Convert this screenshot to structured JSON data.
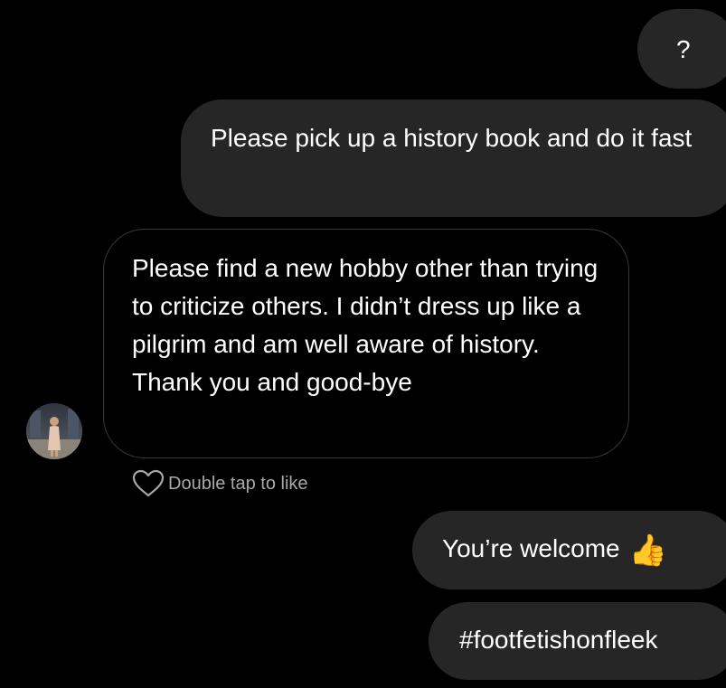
{
  "messages": [
    {
      "id": "m1",
      "direction": "sent",
      "text": "?"
    },
    {
      "id": "m2",
      "direction": "sent",
      "text": "Please pick up a history book and do it fast"
    },
    {
      "id": "m3",
      "direction": "received",
      "text": "Please find a new hobby other than trying to criticize others. I didn’t dress up like a pilgrim and am well aware of history. Thank you and good-bye"
    },
    {
      "id": "m4",
      "direction": "sent",
      "text": "You’re welcome",
      "emoji": "👍"
    },
    {
      "id": "m5",
      "direction": "sent",
      "text": "#footfetishonfleek"
    }
  ],
  "reaction_hint": {
    "label": "Double tap to like",
    "icon": "heart-outline-icon"
  },
  "avatar": {
    "icon": "user-avatar-photo"
  },
  "colors": {
    "background": "#000000",
    "sent_bubble": "#262626",
    "received_border": "#3a3a3a",
    "text": "#ffffff",
    "muted_text": "#a8a8a8"
  }
}
